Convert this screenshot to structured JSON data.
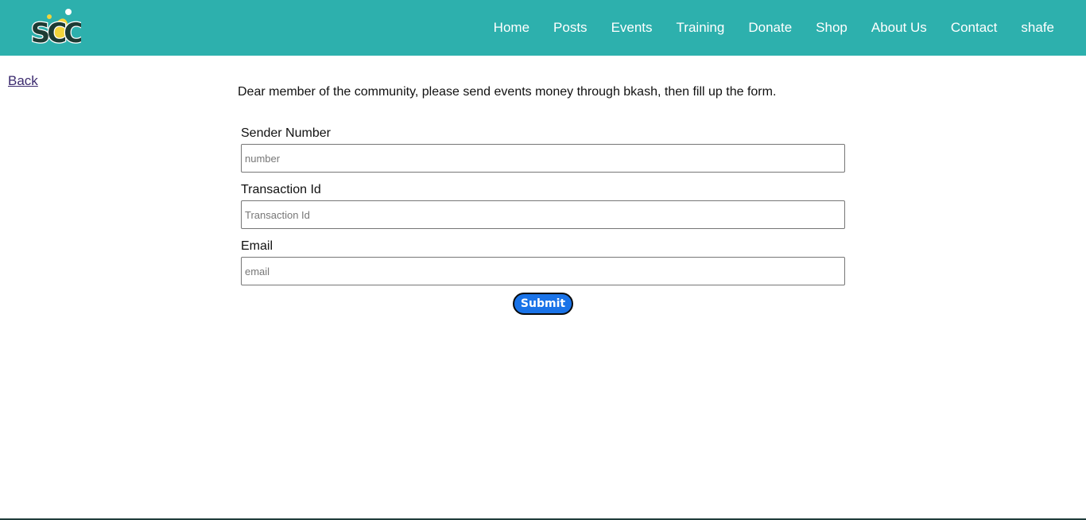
{
  "brand": {
    "logo_text": "SCC",
    "colors": {
      "navbar_bg": "#2db0ad",
      "logo_dark": "#1d3b33",
      "logo_yellow": "#f2d53c",
      "submit_bg": "#1a73e8"
    }
  },
  "nav": {
    "items": [
      {
        "label": "Home"
      },
      {
        "label": "Posts"
      },
      {
        "label": "Events"
      },
      {
        "label": "Training"
      },
      {
        "label": "Donate"
      },
      {
        "label": "Shop"
      },
      {
        "label": "About Us"
      },
      {
        "label": "Contact"
      },
      {
        "label": "shafe"
      }
    ]
  },
  "back_link": "Back",
  "intro_text": "Dear member of the community, please send events money through bkash, then fill up the form.",
  "form": {
    "sender": {
      "label": "Sender Number",
      "placeholder": "number",
      "value": ""
    },
    "transaction": {
      "label": "Transaction Id",
      "placeholder": "Transaction Id",
      "value": ""
    },
    "email": {
      "label": "Email",
      "placeholder": "email",
      "value": ""
    },
    "submit_label": "Submit"
  }
}
